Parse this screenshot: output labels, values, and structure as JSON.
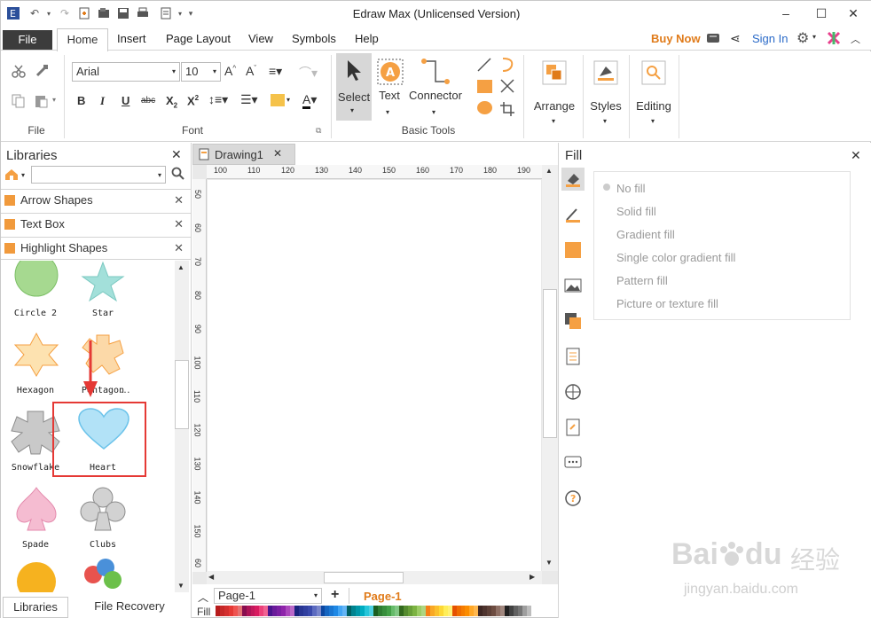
{
  "window": {
    "title": "Edraw Max (Unlicensed Version)"
  },
  "menu": {
    "file": "File",
    "tabs": [
      "Home",
      "Insert",
      "Page Layout",
      "View",
      "Symbols",
      "Help"
    ],
    "buy_now": "Buy Now",
    "sign_in": "Sign In"
  },
  "ribbon": {
    "font_name": "Arial",
    "font_size": "10",
    "groups": {
      "file": "File",
      "font": "Font",
      "basic_tools": "Basic Tools"
    },
    "tools": {
      "select": "Select",
      "text": "Text",
      "connector": "Connector"
    },
    "arrange": "Arrange",
    "styles": "Styles",
    "editing": "Editing"
  },
  "libraries": {
    "title": "Libraries",
    "categories": [
      "Arrow Shapes",
      "Text Box",
      "Highlight Shapes"
    ],
    "shapes": [
      "Circle 2",
      "Star",
      "Hexagon",
      "Pentagon",
      "Snowflake",
      "Heart",
      "Spade",
      "Clubs"
    ],
    "more": "…"
  },
  "document": {
    "tab": "Drawing1",
    "ruler_top": [
      "100",
      "110",
      "120",
      "130",
      "140",
      "150",
      "160",
      "170",
      "180",
      "190"
    ],
    "ruler_left": [
      "50",
      "60",
      "70",
      "80",
      "90",
      "100",
      "110",
      "120",
      "130",
      "140",
      "150",
      "60"
    ]
  },
  "fill_panel": {
    "title": "Fill",
    "options": [
      "No fill",
      "Solid fill",
      "Gradient fill",
      "Single color gradient fill",
      "Pattern fill",
      "Picture or texture fill"
    ]
  },
  "bottom": {
    "page_select": "Page-1",
    "page_tab": "Page-1",
    "fill_label": "Fill",
    "libraries_tab": "Libraries",
    "file_recovery_tab": "File Recovery"
  },
  "watermark": {
    "brand": "Bai",
    "brand2": "du",
    "cn": "经验",
    "url": "jingyan.baidu.com"
  },
  "colors": {
    "accent": "#e07b1a",
    "highlight": "#e53935",
    "shape_orange": "#f5a043",
    "link": "#2a6ac8"
  },
  "palette": [
    "#b71c1c",
    "#c62828",
    "#d32f2f",
    "#e53935",
    "#ef5350",
    "#e57373",
    "#880e4f",
    "#ad1457",
    "#c2185b",
    "#d81b60",
    "#ec407a",
    "#f06292",
    "#4a148c",
    "#6a1b9a",
    "#7b1fa2",
    "#8e24aa",
    "#ab47bc",
    "#ba68c8",
    "#1a237e",
    "#283593",
    "#303f9f",
    "#3949ab",
    "#5c6bc0",
    "#7986cb",
    "#0d47a1",
    "#1565c0",
    "#1976d2",
    "#1e88e5",
    "#42a5f5",
    "#64b5f6",
    "#006064",
    "#00838f",
    "#0097a7",
    "#00acc1",
    "#26c6da",
    "#4dd0e1",
    "#1b5e20",
    "#2e7d32",
    "#388e3c",
    "#43a047",
    "#66bb6a",
    "#81c784",
    "#33691e",
    "#558b2f",
    "#689f38",
    "#7cb342",
    "#9ccc65",
    "#aed581",
    "#f57f17",
    "#f9a825",
    "#fbc02d",
    "#fdd835",
    "#ffee58",
    "#fff176",
    "#e65100",
    "#ef6c00",
    "#f57c00",
    "#fb8c00",
    "#ffa726",
    "#ffb74d",
    "#3e2723",
    "#4e342e",
    "#5d4037",
    "#6d4c41",
    "#8d6e63",
    "#a1887f",
    "#212121",
    "#424242",
    "#616161",
    "#757575",
    "#9e9e9e",
    "#bdbdbd"
  ]
}
